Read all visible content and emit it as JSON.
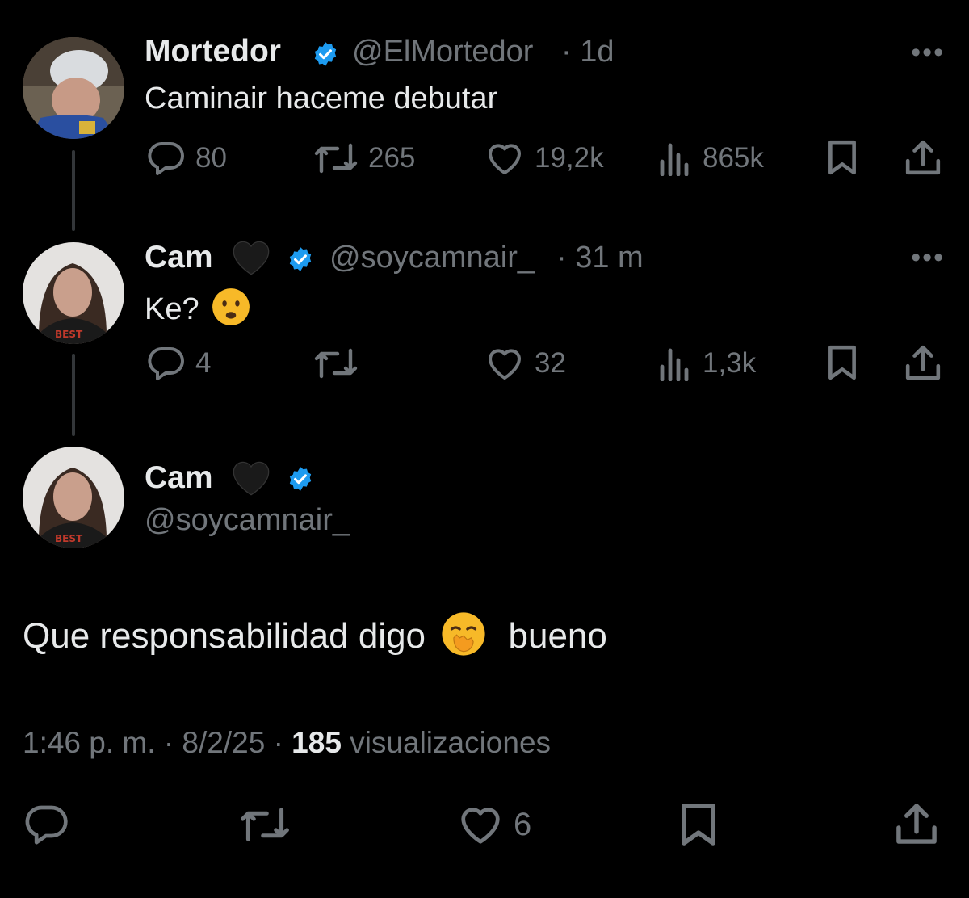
{
  "tweets": [
    {
      "name": "Mortedor",
      "handle": "@ElMortedor",
      "time": "· 1d",
      "text": "Caminair haceme debutar",
      "stats": {
        "replies": "80",
        "reposts": "265",
        "likes": "19,2k",
        "views": "865k"
      }
    },
    {
      "name": "Cam",
      "handle": "@soycamnair_",
      "time": "· 31 m",
      "text": "Ke?",
      "stats": {
        "replies": "4",
        "reposts": "",
        "likes": "32",
        "views": "1,3k"
      }
    }
  ],
  "main": {
    "name": "Cam",
    "handle": "@soycamnair_",
    "text_before": "Que responsabilidad digo",
    "text_after": "bueno",
    "time": "1:46 p. m.",
    "date": "· 8/2/25 ·",
    "views_count": "185",
    "views_label": "visualizaciones",
    "likes": "6"
  },
  "colors": {
    "verified": "#1d9bf0",
    "muted": "#71767b",
    "text": "#e7e9ea",
    "background": "#000000"
  },
  "icons": [
    "reply-icon",
    "repost-icon",
    "like-icon",
    "views-icon",
    "bookmark-icon",
    "share-icon",
    "verified-badge-icon",
    "more-icon",
    "black-heart-emoji",
    "frowning-emoji",
    "hand-over-mouth-emoji"
  ]
}
